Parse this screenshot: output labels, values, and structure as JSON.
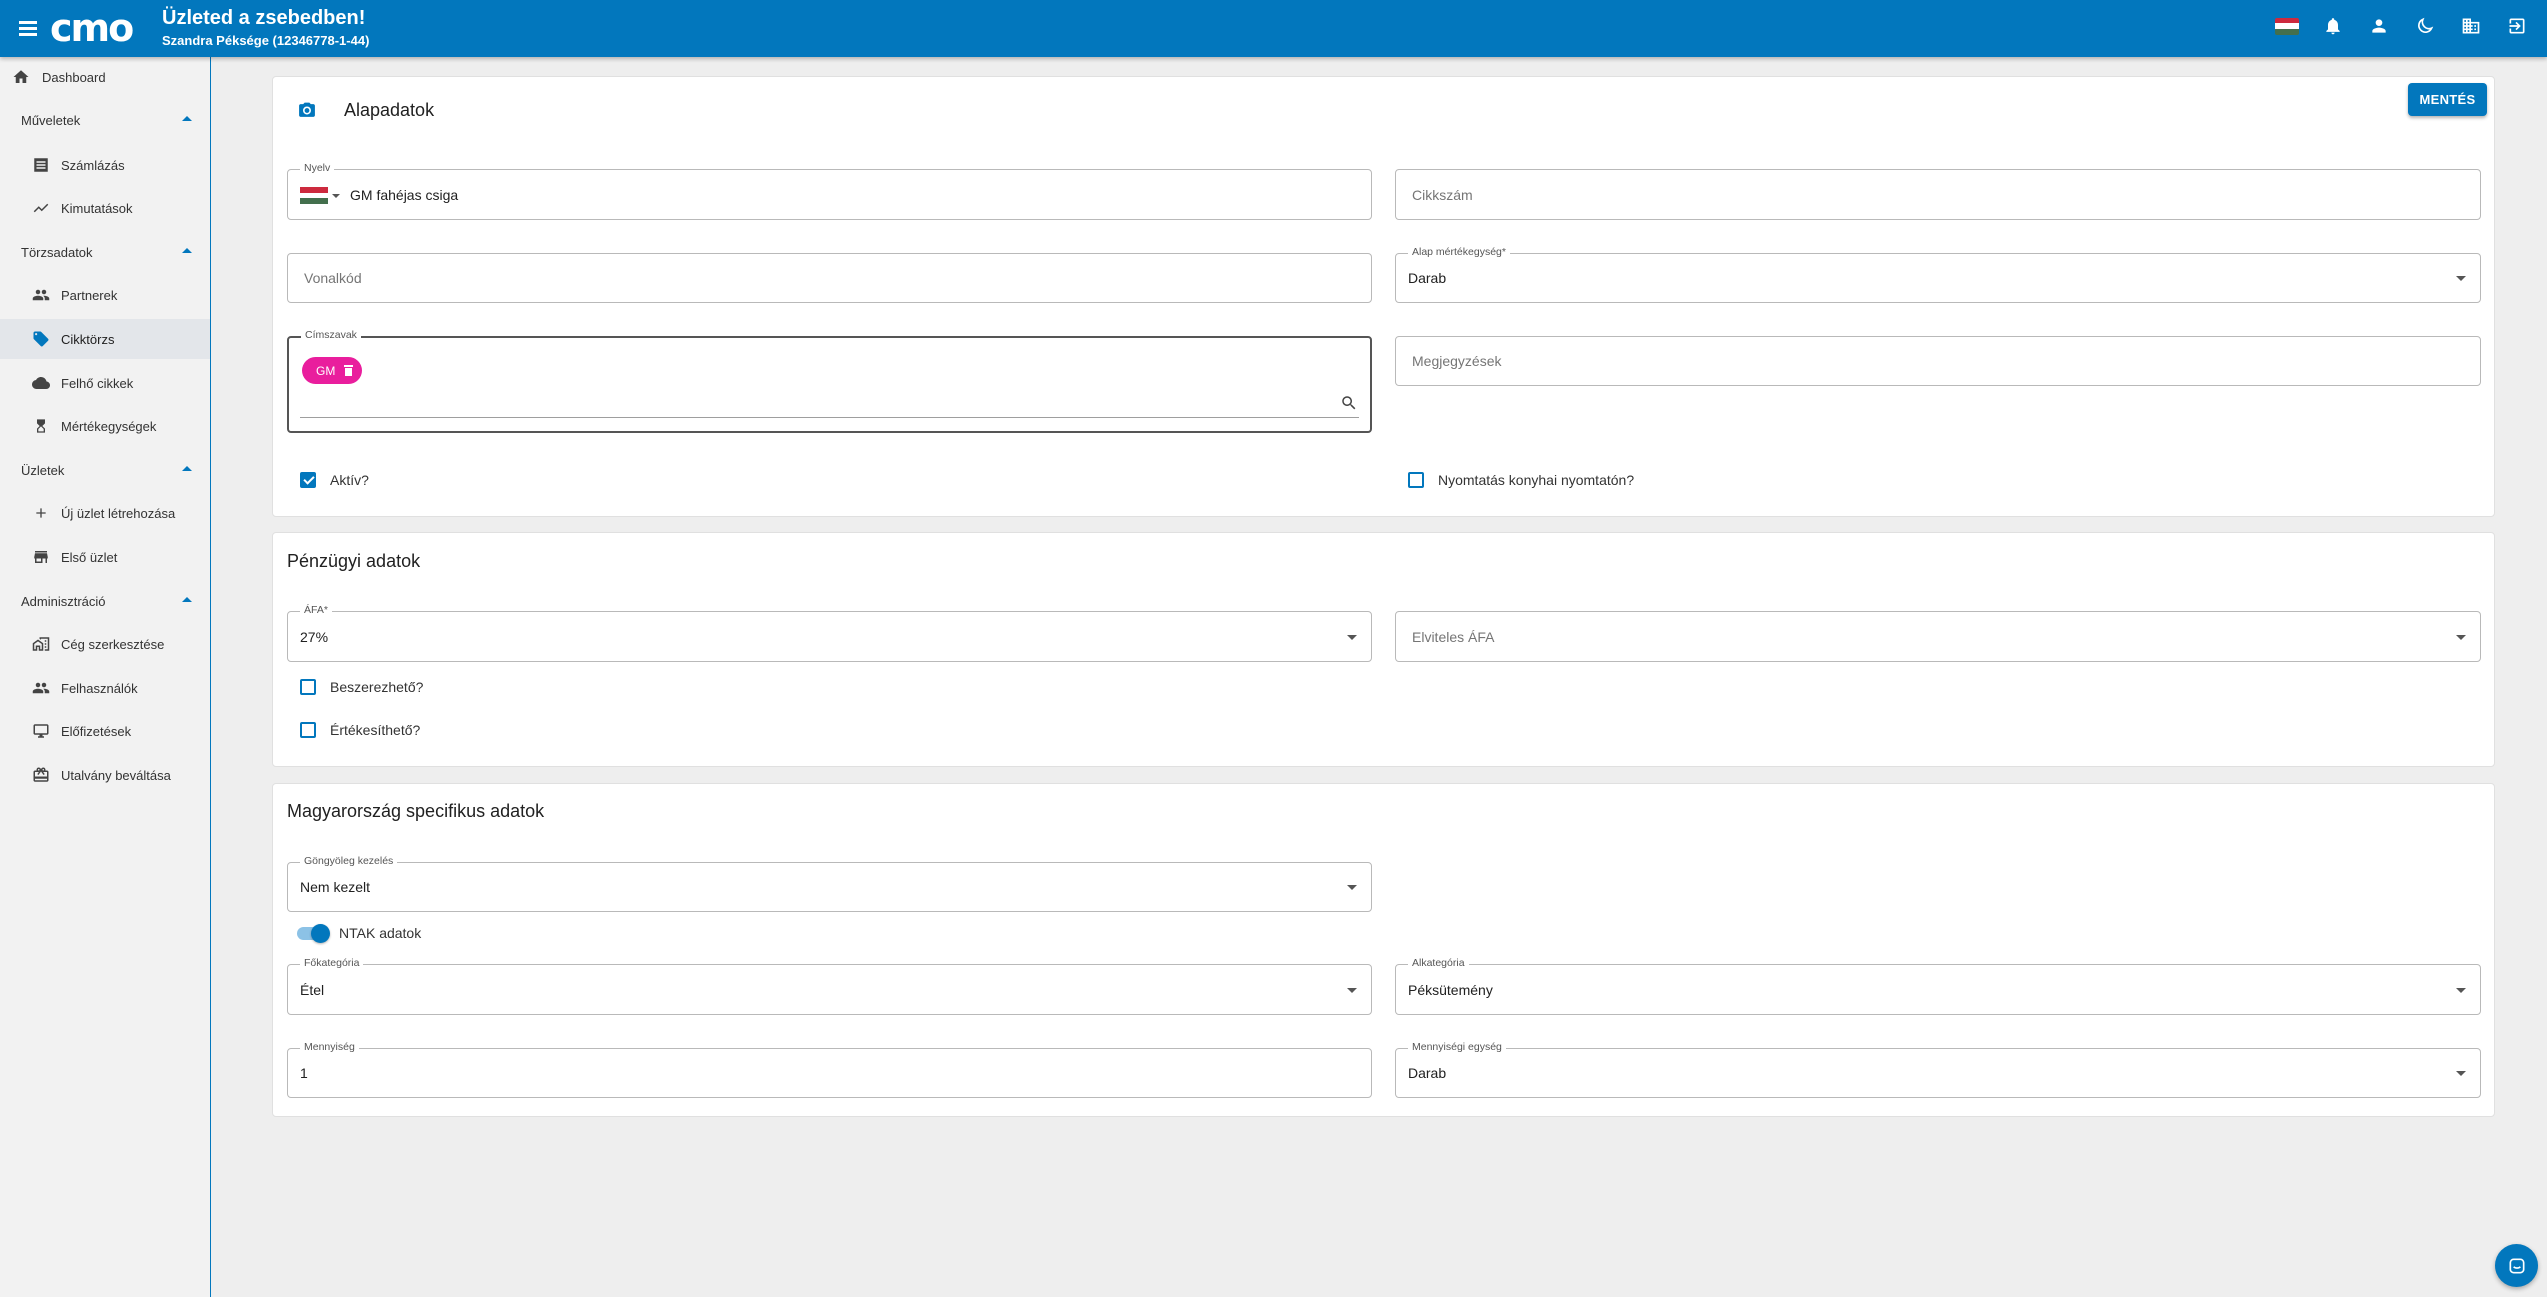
{
  "header": {
    "logo_text": "cmo",
    "title": "Üzleted a zsebedben!",
    "subtitle": "Szandra Péksége (12346778-1-44)",
    "icons": [
      "hungarian-flag",
      "bell-icon",
      "account-icon",
      "dark-mode-icon",
      "business-icon",
      "logout-icon"
    ]
  },
  "sidebar": {
    "dashboard": "Dashboard",
    "groups": {
      "muveletek": "Műveletek",
      "torzsadatok": "Törzsadatok",
      "uzletek": "Üzletek",
      "adminisztracio": "Adminisztráció"
    },
    "items": {
      "szamlazas": "Számlázás",
      "kimutatasok": "Kimutatások",
      "partnerek": "Partnerek",
      "cikktorzs": "Cikktörzs",
      "felho_cikkek": "Felhő cikkek",
      "mertekegysegek": "Mértékegységek",
      "uj_uzlet": "Új üzlet létrehozása",
      "elso_uzlet": "Első üzlet",
      "ceg_szerkesztese": "Cég szerkesztése",
      "felhasznalok": "Felhasználók",
      "elofizetesek": "Előfizetések",
      "utalvany": "Utalvány beváltása"
    },
    "active": "Cikktörzs"
  },
  "basic": {
    "title": "Alapadatok",
    "save_label": "MENTÉS",
    "name_label": "Nyelv",
    "name_value": "GM fahéjas csiga",
    "sku_placeholder": "Cikkszám",
    "barcode_placeholder": "Vonalkód",
    "unit_label": "Alap mértékegység*",
    "unit_value": "Darab",
    "tags_label": "Címszavak",
    "tag_chip": "GM",
    "notes_placeholder": "Megjegyzések",
    "active_label": "Aktív?",
    "active_checked": true,
    "kitchen_print_label": "Nyomtatás konyhai nyomtatón?",
    "kitchen_print_checked": false
  },
  "finance": {
    "title": "Pénzügyi adatok",
    "vat_label": "ÁFA*",
    "vat_value": "27%",
    "takeaway_vat_placeholder": "Elviteles ÁFA",
    "purchasable_label": "Beszerezhető?",
    "purchasable_checked": false,
    "sellable_label": "Értékesíthető?",
    "sellable_checked": false
  },
  "hungary": {
    "title": "Magyarország specifikus adatok",
    "roll_label": "Göngyöleg kezelés",
    "roll_value": "Nem kezelt",
    "ntak_label": "NTAK adatok",
    "ntak_on": true,
    "main_cat_label": "Főkategória",
    "main_cat_value": "Étel",
    "sub_cat_label": "Alkategória",
    "sub_cat_value": "Péksütemény",
    "qty_label": "Mennyiség",
    "qty_value": "1",
    "qty_unit_label": "Mennyiségi egység",
    "qty_unit_value": "Darab"
  },
  "colors": {
    "primary": "#0277bd",
    "chip": "#e91e9d",
    "background": "#eeeeee"
  }
}
